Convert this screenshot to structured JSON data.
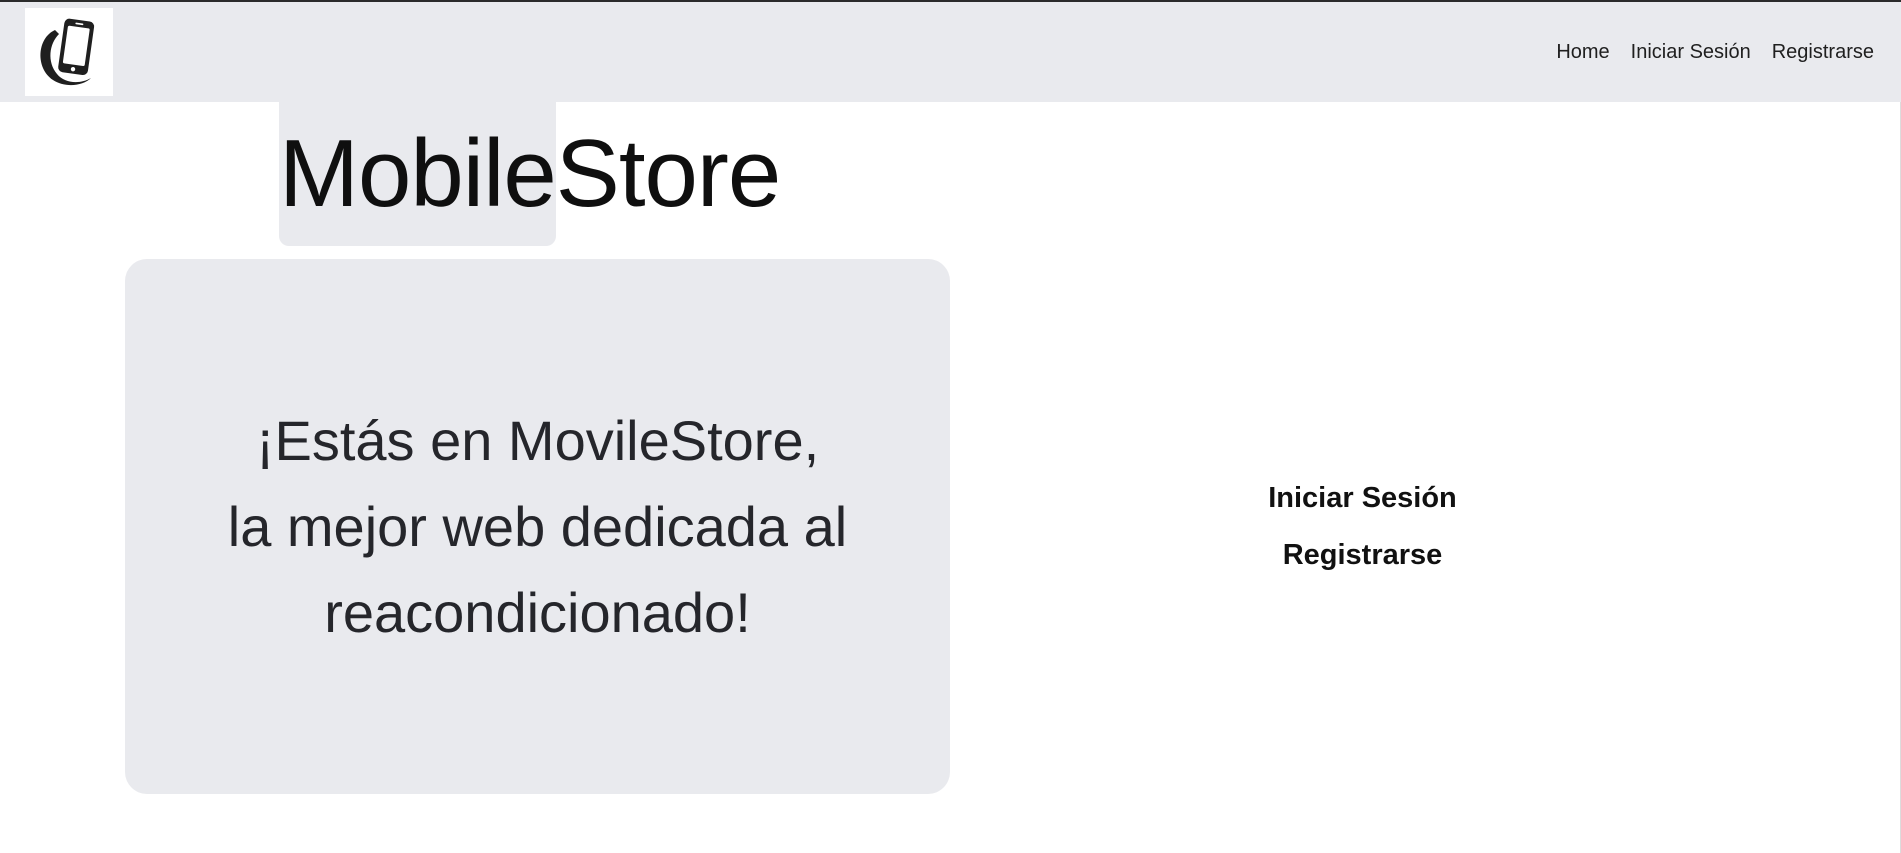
{
  "nav": {
    "logo": "phone-logo-icon",
    "links": [
      "Home",
      "Iniciar Sesión",
      "Registrarse"
    ]
  },
  "brand": {
    "part1": "Mobile",
    "part2": "Store"
  },
  "hero": {
    "line1": "¡Estás en MovileStore,",
    "line2": "la mejor web dedicada al",
    "line3": "reacondicionado!"
  },
  "actions": {
    "login": "Iniciar Sesión",
    "register": "Registrarse"
  },
  "colors": {
    "navbar_bg": "#e9eaee",
    "card_bg": "#e9eaee",
    "text": "#25262b"
  }
}
